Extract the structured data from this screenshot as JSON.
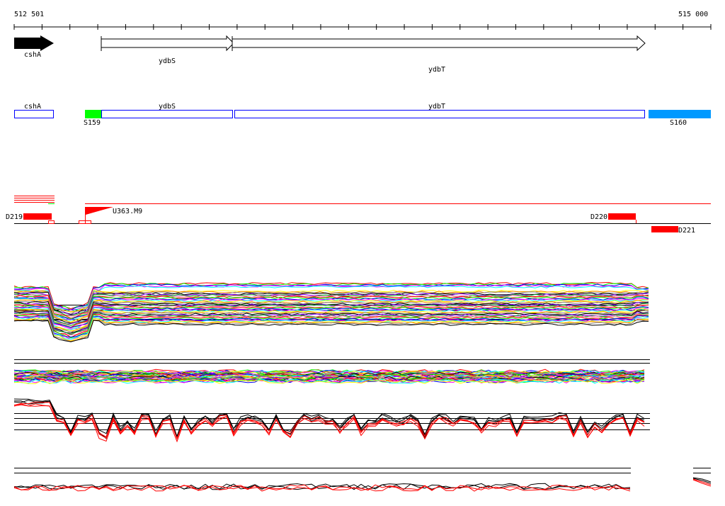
{
  "ruler": {
    "start": "512 501",
    "end": "515 000"
  },
  "genes": [
    {
      "name": "cshA",
      "strand": "+"
    },
    {
      "name": "ydbS",
      "strand": "+"
    },
    {
      "name": "ydbT",
      "strand": "+"
    }
  ],
  "segments": {
    "s159": "S159",
    "s160": "S160"
  },
  "features": {
    "d219": "D219",
    "u363": "U363.M9",
    "d220": "D220",
    "d221": "D221"
  },
  "colors": {
    "green": "#00ff00",
    "blue": "#0099ff",
    "red": "#ff0000",
    "box": "#0000ff"
  }
}
